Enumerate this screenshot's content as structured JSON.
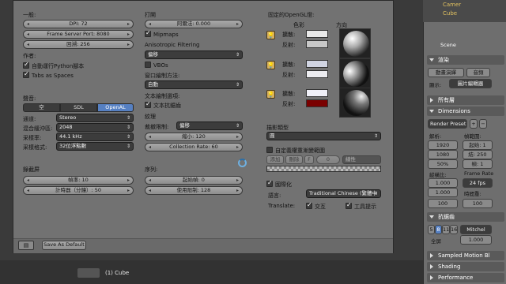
{
  "viewport": {
    "object_label": "(1) Cube"
  },
  "outliner": {
    "items": [
      "Camer",
      "Cube"
    ]
  },
  "right_panel": {
    "scene_label": "Scene",
    "render_header": "渲染",
    "render_anim_label": "動畫演繹",
    "audio_btn": "音頻",
    "display_label": "顯示:",
    "display_value": "圖片編輯器",
    "layers_header": "所有層",
    "dimensions_header": "Dimensions",
    "render_preset": "Render Preset",
    "resolution_label": "解析:",
    "frame_range_label": "幀範圍:",
    "res_x": "1920",
    "res_y": "1080",
    "res_pct": "50%",
    "frame_start": "起始: 1",
    "frame_end": "結: 250",
    "frame_step": "幀: 1",
    "aspect_label": "縱橫比:",
    "frame_rate_label": "Frame Rate",
    "aspect_x": "1.000",
    "aspect_y": "1.000",
    "fps": "24 fps",
    "time_remap_label": "時間重:",
    "time_old": "100",
    "time_new": "100",
    "aa_header": "抗鋸齒",
    "aa_samples": [
      "5",
      "8",
      "11",
      "16"
    ],
    "aa_filter": "Mitchel",
    "full_label": "全屏",
    "aa_size": "1.000",
    "motion_blur_header": "Sampled Motion Bl",
    "shading_header": "Shading",
    "performance_header": "Performance"
  },
  "prefs": {
    "general": {
      "title": "一般:",
      "dpi": "DPI: 72",
      "frame_server_port": "Frame Server Port: 8080",
      "backup": "回溯: 256",
      "author_label": "作者:",
      "auto_run_python": "自動運行Python腳本",
      "tabs_as_spaces": "Tabs as Spaces"
    },
    "sound": {
      "title": "聲音:",
      "options": [
        "空",
        "SDL",
        "OpenAL"
      ],
      "selected": "OpenAL",
      "channels_label": "通道:",
      "channels_value": "Stereo",
      "mix_buffer_label": "混合緩沖區:",
      "mix_buffer_value": "2048",
      "sample_rate_label": "采樣率:",
      "sample_rate_value": "44.1 kHz",
      "sample_format_label": "采樣格式:",
      "sample_format_value": "32位浮點數"
    },
    "screencast": {
      "title": "錄截屏",
      "fps": "幀率: 10",
      "wait_timer": "計時器（分鐘）: 50"
    },
    "opengl": {
      "title": "打開",
      "clip_alpha": "阿爾法: 0.000",
      "mipmaps": "Mipmaps",
      "aniso_label": "Anisotropic Filtering",
      "aniso_value": "偏移",
      "vbos": "VBOs",
      "window_draw_label": "窗口繪制方法:",
      "window_draw_value": "自動",
      "text_aa_label": "文本繪制選項:",
      "text_aa": "文本抗鋸齒",
      "textures_title": "紋理",
      "limit_size_label": "裁撤限制:",
      "limit_size_value": "偏移",
      "time_out": "縮小: 120",
      "collection_rate": "Collection Rate: 60"
    },
    "sequencer": {
      "title": "序列:",
      "prefetch": "起始幀: 0",
      "memory_limit": "使用限制: 128"
    },
    "lights": {
      "title": "固定的OpenGL燈:",
      "colors_label": "色彩",
      "direction_label": "方向",
      "diffuse_label": "擴散:",
      "specular_label": "反射:",
      "swatches": [
        "#e8e8e8",
        "#c8c8c8",
        "#d0d4e2",
        "#ececf0",
        "#f0f0f8",
        "#7a0000"
      ]
    },
    "color_picker": {
      "title": "描影類型",
      "value": "圓"
    },
    "custom_weight": {
      "label": "自定義權重漸變範圍",
      "add_label": "添加",
      "delete_label": "刪除",
      "flip_label": "F",
      "index_label": "0",
      "linear_label": "線性"
    },
    "international": {
      "title": "國際化",
      "language_label": "語言:",
      "language_value": "Traditional Chinese (繁體中",
      "translate_label": "Translate:",
      "interface": "交互",
      "tooltips": "工具提示"
    },
    "footer": {
      "save_as_default": "Save As Default"
    }
  }
}
